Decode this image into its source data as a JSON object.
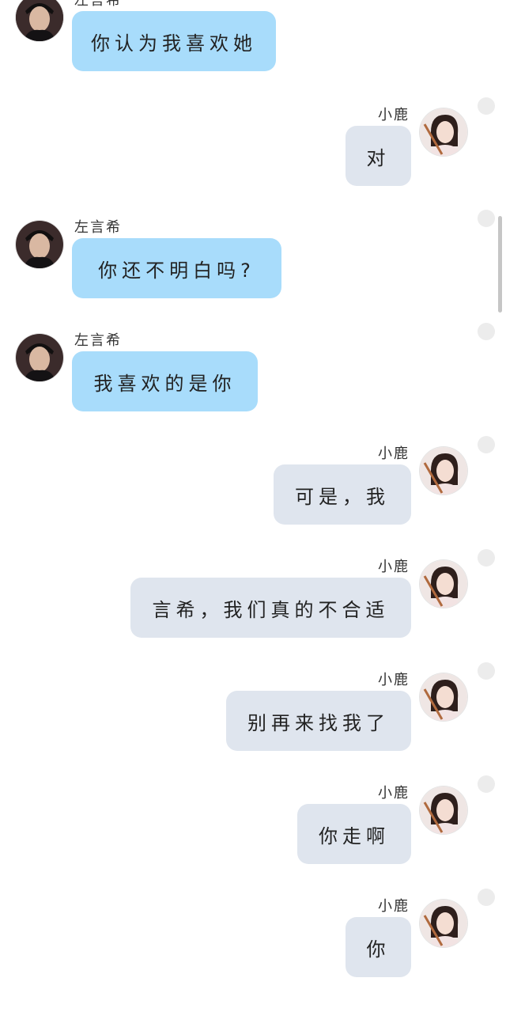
{
  "chat": {
    "messages": [
      {
        "side": "left",
        "avatar": "male-avatar",
        "name": "左言希",
        "text": "你认为我喜欢她"
      },
      {
        "side": "right",
        "avatar": "female-avatar",
        "name": "小鹿",
        "text": "对"
      },
      {
        "side": "left",
        "avatar": "male-avatar",
        "name": "左言希",
        "text": "你还不明白吗?"
      },
      {
        "side": "left",
        "avatar": "male-avatar",
        "name": "左言希",
        "text": "我喜欢的是你"
      },
      {
        "side": "right",
        "avatar": "female-avatar",
        "name": "小鹿",
        "text": "可是，我"
      },
      {
        "side": "right",
        "avatar": "female-avatar",
        "name": "小鹿",
        "text": "言希，我们真的不合适"
      },
      {
        "side": "right",
        "avatar": "female-avatar",
        "name": "小鹿",
        "text": "别再来找我了"
      },
      {
        "side": "right",
        "avatar": "female-avatar",
        "name": "小鹿",
        "text": "你走啊"
      },
      {
        "side": "right",
        "avatar": "female-avatar",
        "name": "小鹿",
        "text": "你"
      }
    ]
  },
  "colors": {
    "left_bubble": "#a8dcfb",
    "right_bubble": "#dfe5ee",
    "select_dot": "#ececec",
    "background": "#ffffff"
  }
}
